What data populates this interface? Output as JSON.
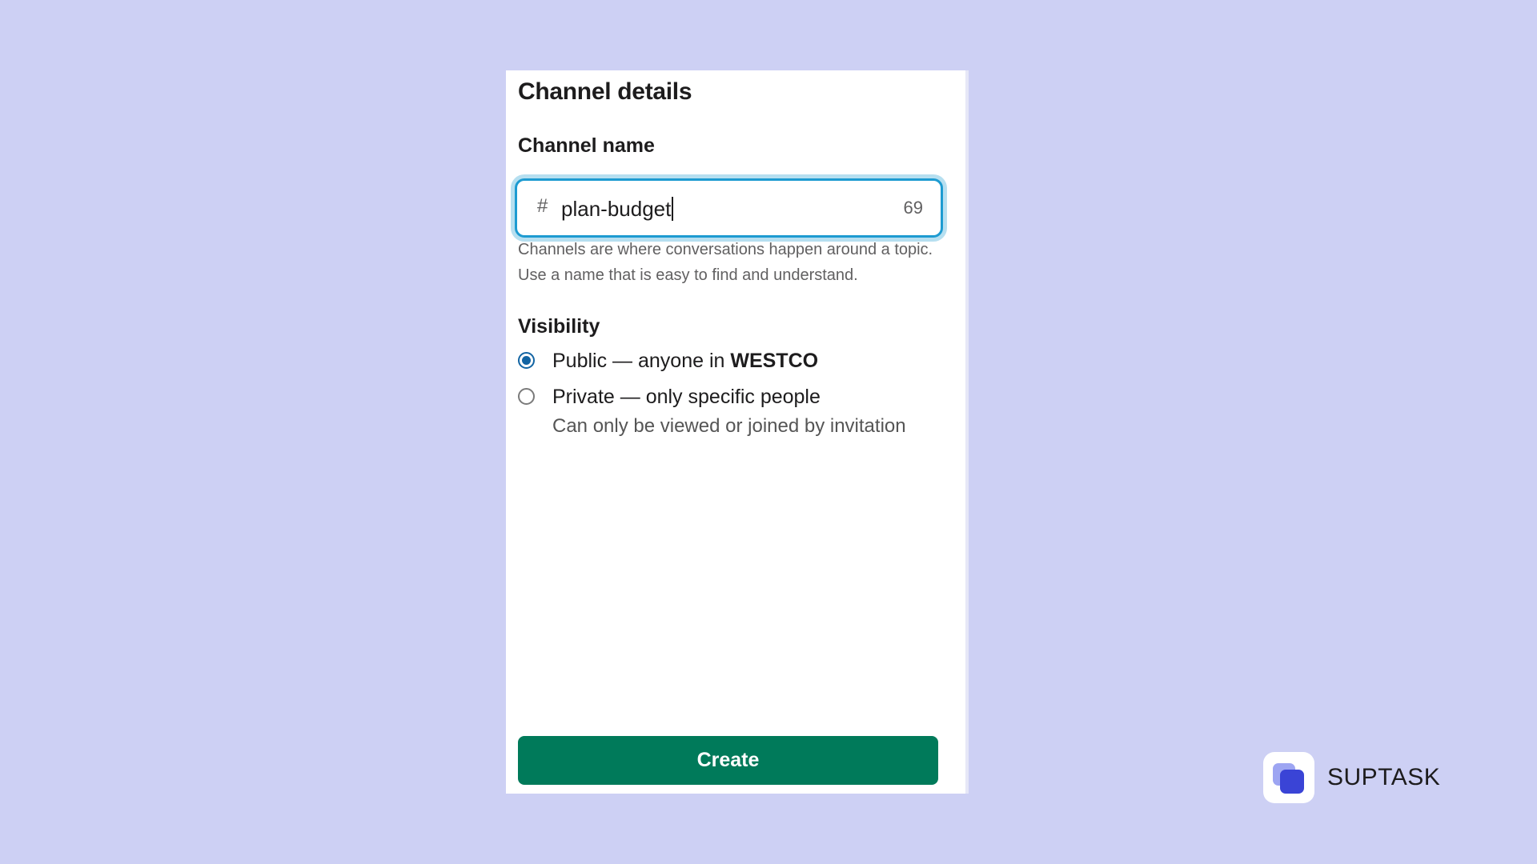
{
  "dialog": {
    "title": "Channel details",
    "channel_name_label": "Channel name",
    "channel_prefix": "#",
    "channel_name_value": "plan-budget",
    "char_counter": "69",
    "help_text": "Channels are where conversations happen around a topic. Use a name that is easy to find and understand.",
    "visibility_label": "Visibility",
    "options": {
      "public": {
        "text": "Public — anyone in ",
        "org": "WESTCO",
        "checked": true
      },
      "private": {
        "text": "Private — only specific people",
        "sub": "Can only be viewed or joined by invitation",
        "checked": false
      }
    },
    "create_label": "Create"
  },
  "brand": {
    "name": "SUPTASK",
    "icon": "suptask-logo-icon"
  },
  "colors": {
    "background": "#cdd0f4",
    "focus_border": "#1d9bd1",
    "radio_selected": "#1264a3",
    "create_button": "#007a5a"
  }
}
